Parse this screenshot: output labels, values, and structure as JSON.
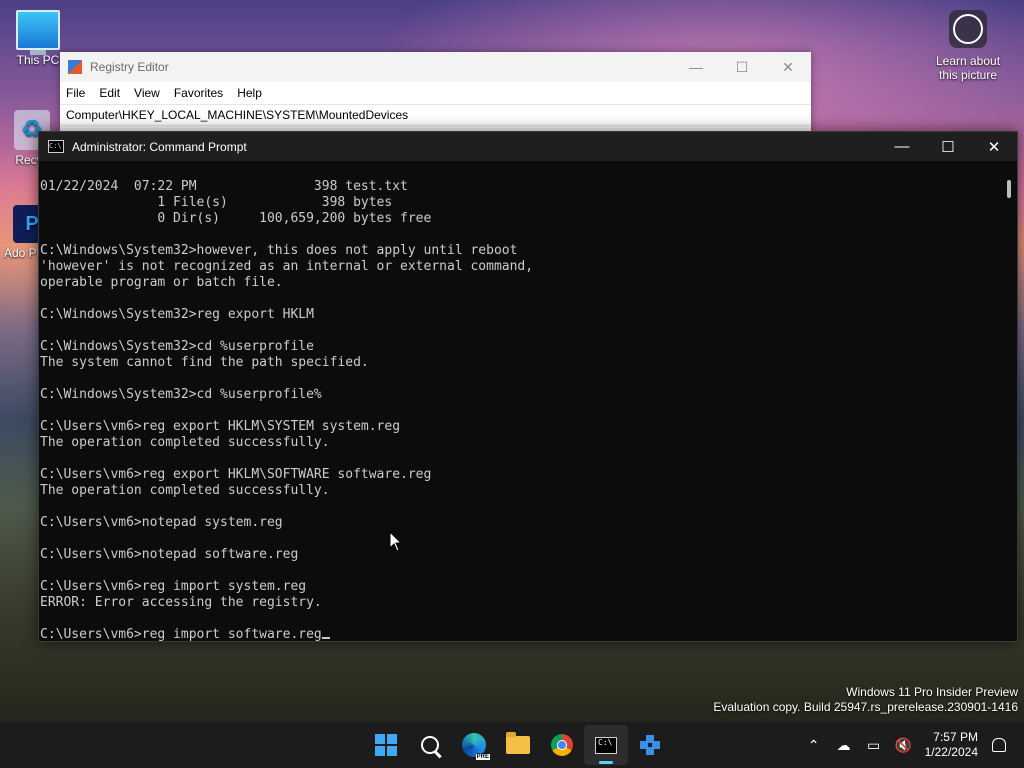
{
  "desktop": {
    "icons": [
      {
        "label": "This PC"
      },
      {
        "label": "Recyc"
      },
      {
        "label": "Ado Photo"
      }
    ],
    "learn": {
      "line1": "Learn about",
      "line2": "this picture"
    },
    "watermark": {
      "line1": "Windows 11 Pro Insider Preview",
      "line2": "Evaluation copy. Build 25947.rs_prerelease.230901-1416"
    }
  },
  "regedit": {
    "title": "Registry Editor",
    "menu": [
      "File",
      "Edit",
      "View",
      "Favorites",
      "Help"
    ],
    "address": "Computer\\HKEY_LOCAL_MACHINE\\SYSTEM\\MountedDevices"
  },
  "cmd": {
    "title": "Administrator: Command Prompt",
    "icon_text": "C:\\",
    "lines": [
      "01/22/2024  07:22 PM               398 test.txt",
      "               1 File(s)            398 bytes",
      "               0 Dir(s)     100,659,200 bytes free",
      "",
      "C:\\Windows\\System32>however, this does not apply until reboot",
      "'however' is not recognized as an internal or external command,",
      "operable program or batch file.",
      "",
      "C:\\Windows\\System32>reg export HKLM",
      "",
      "C:\\Windows\\System32>cd %userprofile",
      "The system cannot find the path specified.",
      "",
      "C:\\Windows\\System32>cd %userprofile%",
      "",
      "C:\\Users\\vm6>reg export HKLM\\SYSTEM system.reg",
      "The operation completed successfully.",
      "",
      "C:\\Users\\vm6>reg export HKLM\\SOFTWARE software.reg",
      "The operation completed successfully.",
      "",
      "C:\\Users\\vm6>notepad system.reg",
      "",
      "C:\\Users\\vm6>notepad software.reg",
      "",
      "C:\\Users\\vm6>reg import system.reg",
      "ERROR: Error accessing the registry.",
      "",
      "C:\\Users\\vm6>reg import software.reg"
    ]
  },
  "taskbar": {
    "apps": [
      {
        "name": "start",
        "icon": "windows-logo-icon"
      },
      {
        "name": "search",
        "icon": "search-icon"
      },
      {
        "name": "edge-preview",
        "icon": "edge-icon",
        "badge": "PRE"
      },
      {
        "name": "file-explorer",
        "icon": "folder-icon"
      },
      {
        "name": "chrome",
        "icon": "chrome-icon"
      },
      {
        "name": "command-prompt",
        "icon": "terminal-icon",
        "active": true
      },
      {
        "name": "registry-editor",
        "icon": "registry-icon"
      }
    ],
    "time": "7:57 PM",
    "date": "1/22/2024"
  },
  "colors": {
    "console_bg": "#0c0c0c",
    "console_text": "#cccccc",
    "taskbar_bg": "#1c1c1c",
    "accent": "#60cdff"
  }
}
